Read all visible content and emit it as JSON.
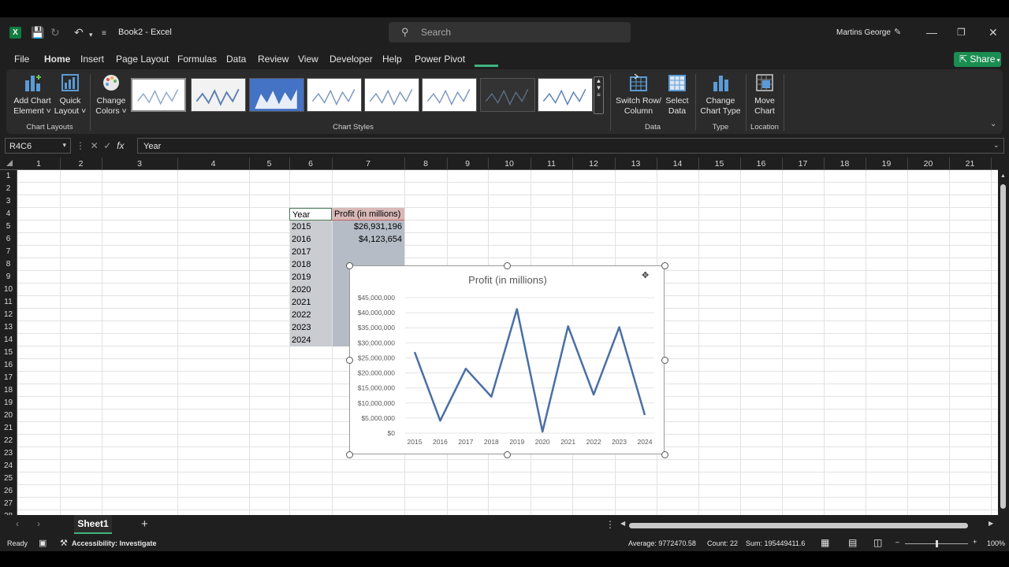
{
  "titlebar": {
    "app_icon": "X",
    "title": "Book2  -  Excel",
    "search_placeholder": "Search",
    "user": "Martins George"
  },
  "menu": [
    "File",
    "Home",
    "Insert",
    "Page Layout",
    "Formulas",
    "Data",
    "Review",
    "View",
    "Developer",
    "Help",
    "Power Pivot"
  ],
  "share_label": "Share",
  "ribbon": {
    "add_chart_element": [
      "Add Chart",
      "Element ˅"
    ],
    "quick_layout": [
      "Quick",
      "Layout ˅"
    ],
    "change_colors": [
      "Change",
      "Colors ˅"
    ],
    "chart_layouts_group": "Chart Layouts",
    "chart_styles_group": "Chart Styles",
    "switch_row_col": [
      "Switch Row/",
      "Column"
    ],
    "select_data": [
      "Select",
      "Data"
    ],
    "data_group": "Data",
    "change_chart_type": [
      "Change",
      "Chart Type"
    ],
    "type_group": "Type",
    "move_chart": [
      "Move",
      "Chart"
    ],
    "location_group": "Location"
  },
  "formula": {
    "namebox": "R4C6",
    "content": "Year"
  },
  "columns": [
    "1",
    "2",
    "3",
    "4",
    "5",
    "6",
    "7",
    "8",
    "9",
    "10",
    "11",
    "12",
    "13",
    "14",
    "15",
    "16",
    "17",
    "18",
    "19",
    "20",
    "21"
  ],
  "rows": [
    "1",
    "2",
    "3",
    "4",
    "5",
    "6",
    "7",
    "8",
    "9",
    "10",
    "11",
    "12",
    "13",
    "14",
    "15",
    "16",
    "17",
    "18",
    "19",
    "20",
    "21",
    "22",
    "23",
    "24",
    "25",
    "26",
    "27",
    "28"
  ],
  "table": {
    "header_year": "Year",
    "header_profit": "Profit (in millions)",
    "years": [
      "2015",
      "2016",
      "2017",
      "2018",
      "2019",
      "2020",
      "2021",
      "2022",
      "2023",
      "2024"
    ],
    "profit_visible": [
      "$26,931,196",
      "$4,123,654"
    ]
  },
  "chart_data": {
    "type": "line",
    "title": "Profit (in millions)",
    "categories": [
      "2015",
      "2016",
      "2017",
      "2018",
      "2019",
      "2020",
      "2021",
      "2022",
      "2023",
      "2024"
    ],
    "values": [
      26931196,
      4123654,
      21400000,
      12100000,
      41200000,
      500000,
      35500000,
      12800000,
      35200000,
      6000000
    ],
    "ylim": [
      0,
      45000000
    ],
    "yticks": [
      "$0",
      "$5,000,000",
      "$10,000,000",
      "$15,000,000",
      "$20,000,000",
      "$25,000,000",
      "$30,000,000",
      "$35,000,000",
      "$40,000,000",
      "$45,000,000"
    ],
    "grid": true,
    "line_color": "#4a6fa5"
  },
  "sheet_tab": "Sheet1",
  "status": {
    "ready": "Ready",
    "accessibility": "Accessibility: Investigate",
    "average": "Average: 9772470.58",
    "count": "Count: 22",
    "sum": "Sum: 195449411.6",
    "zoom": "100%"
  }
}
